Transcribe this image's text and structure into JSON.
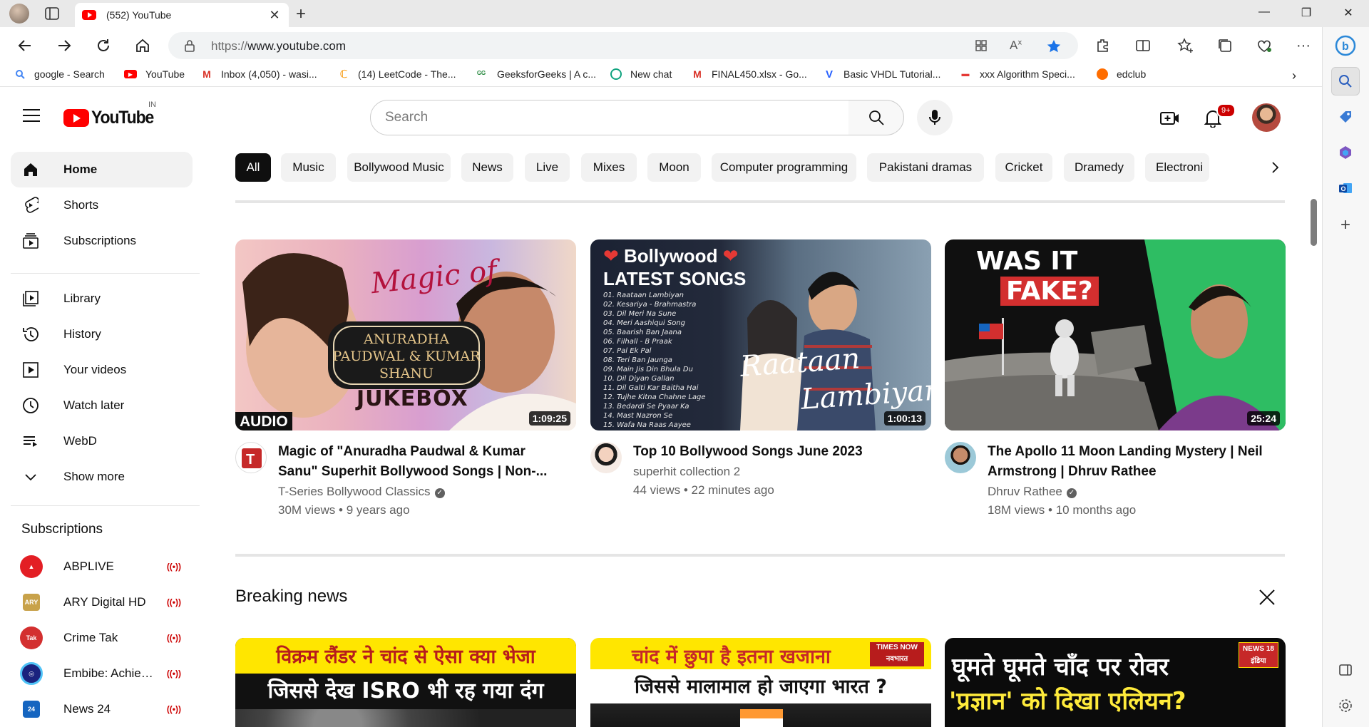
{
  "browser": {
    "tab_title": "(552) YouTube",
    "url_scheme": "https://",
    "url_host": "www.youtube.com",
    "bookmarks": [
      {
        "label": "google - Search",
        "icon": "google-icon",
        "color": "#4285f4"
      },
      {
        "label": "YouTube",
        "icon": "youtube-icon",
        "color": "#ff0000"
      },
      {
        "label": "Inbox (4,050) - wasi...",
        "icon": "gmail-icon",
        "color": "#d93025"
      },
      {
        "label": "(14) LeetCode - The...",
        "icon": "leetcode-icon",
        "color": "#f89f1b"
      },
      {
        "label": "GeeksforGeeks | A c...",
        "icon": "geeksforgeeks-icon",
        "color": "#2f8d46"
      },
      {
        "label": "New chat",
        "icon": "chatgpt-icon",
        "color": "#10a37f"
      },
      {
        "label": "FINAL450.xlsx - Go...",
        "icon": "gmail-icon",
        "color": "#d93025"
      },
      {
        "label": "Basic VHDL Tutorial...",
        "icon": "vhdl-icon",
        "color": "#2962ff"
      },
      {
        "label": "xxx Algorithm Speci...",
        "icon": "bookmark-icon",
        "color": "#e53935"
      },
      {
        "label": "edclub",
        "icon": "edclub-icon",
        "color": "#ff6d00"
      }
    ]
  },
  "youtube": {
    "logo_text": "YouTube",
    "country_code": "IN",
    "search_placeholder": "Search",
    "notification_count": "9+",
    "sidebar": {
      "primary": [
        {
          "label": "Home",
          "icon": "home-icon",
          "active": true
        },
        {
          "label": "Shorts",
          "icon": "shorts-icon"
        },
        {
          "label": "Subscriptions",
          "icon": "subscriptions-icon"
        }
      ],
      "library": [
        {
          "label": "Library",
          "icon": "library-icon"
        },
        {
          "label": "History",
          "icon": "history-icon"
        },
        {
          "label": "Your videos",
          "icon": "your-videos-icon"
        },
        {
          "label": "Watch later",
          "icon": "watch-later-icon"
        },
        {
          "label": "WebD",
          "icon": "playlist-icon"
        },
        {
          "label": "Show more",
          "icon": "chevron-down-icon"
        }
      ],
      "subscriptions_heading": "Subscriptions",
      "subscriptions": [
        {
          "label": "ABPLIVE",
          "color": "#e31e24",
          "live_icon": "live-icon"
        },
        {
          "label": "ARY Digital HD",
          "color": "#c8a24a",
          "live_icon": "live-icon"
        },
        {
          "label": "Crime Tak",
          "color": "#d32f2f",
          "live_icon": "live-icon"
        },
        {
          "label": "Embibe: Achieve ...",
          "color": "#1a237e",
          "live_icon": "live-icon"
        },
        {
          "label": "News 24",
          "color": "#1565c0",
          "live_icon": "live-icon"
        }
      ]
    },
    "chips": [
      "All",
      "Music",
      "Bollywood Music",
      "News",
      "Live",
      "Mixes",
      "Moon",
      "Computer programming",
      "Pakistani dramas",
      "Cricket",
      "Dramedy",
      "Electroni"
    ],
    "videos": [
      {
        "title": "Magic of \"Anuradha Paudwal & Kumar Sanu\" Superhit Bollywood Songs | Non-...",
        "channel": "T-Series Bollywood Classics",
        "verified": true,
        "stats": "30M views • 9 years ago",
        "duration": "1:09:25",
        "thumb_text": {
          "script": "Magic of",
          "names": "ANURADHA PAUDWAL & KUMAR SHANU",
          "jukebox": "JUKEBOX",
          "badge": "AUDIO"
        }
      },
      {
        "title": "Top 10 Bollywood Songs June 2023",
        "channel": "superhit collection 2",
        "verified": false,
        "stats": "44 views • 22 minutes ago",
        "duration": "1:00:13",
        "thumb_text": {
          "heading1": "Bollywood",
          "heading2": "LATEST SONGS",
          "script1": "Raataan",
          "script2": "Lambiyan",
          "songs": [
            "01. Raataan Lambiyan",
            "02. Kesariya - Brahmastra",
            "03. Dil Meri Na Sune",
            "04. Meri Aashiqui Song",
            "05. Baarish Ban Jaana",
            "06. Filhall - B Praak",
            "07. Pal Ek Pal",
            "08. Teri Ban Jaunga",
            "09. Main Jis Din Bhula Du",
            "10. Dil Diyan Gallan",
            "11. Dil Galti Kar Baitha Hai",
            "12. Tujhe Kitna Chahne Lage",
            "13. Bedardi Se Pyaar Ka",
            "14. Mast Nazron Se",
            "15. Wafa Na Raas Aayee"
          ]
        }
      },
      {
        "title": "The Apollo 11 Moon Landing Mystery | Neil Armstrong | Dhruv Rathee",
        "channel": "Dhruv Rathee",
        "verified": true,
        "stats": "18M views • 10 months ago",
        "duration": "25:24",
        "thumb_text": {
          "line1": "WAS IT",
          "line2": "FAKE?"
        }
      }
    ],
    "breaking_news": {
      "heading": "Breaking news",
      "thumbs": [
        {
          "line1": "विक्रम लैंडर ने चांद से ऐसा क्या भेजा",
          "line2": "जिससे देख ISRO भी रह गया दंग"
        },
        {
          "line1": "चांद में छुपा है इतना खजाना",
          "line2": "जिससे मालामाल हो जाएगा भारत ?",
          "brand": "TIMES NOW नवभारत"
        },
        {
          "line1": "घूमते घूमते चाँद पर रोवर",
          "line2": "'प्रज्ञान' को दिखा एलियन?",
          "brand": "NEWS 18 इंडिया"
        }
      ]
    }
  }
}
